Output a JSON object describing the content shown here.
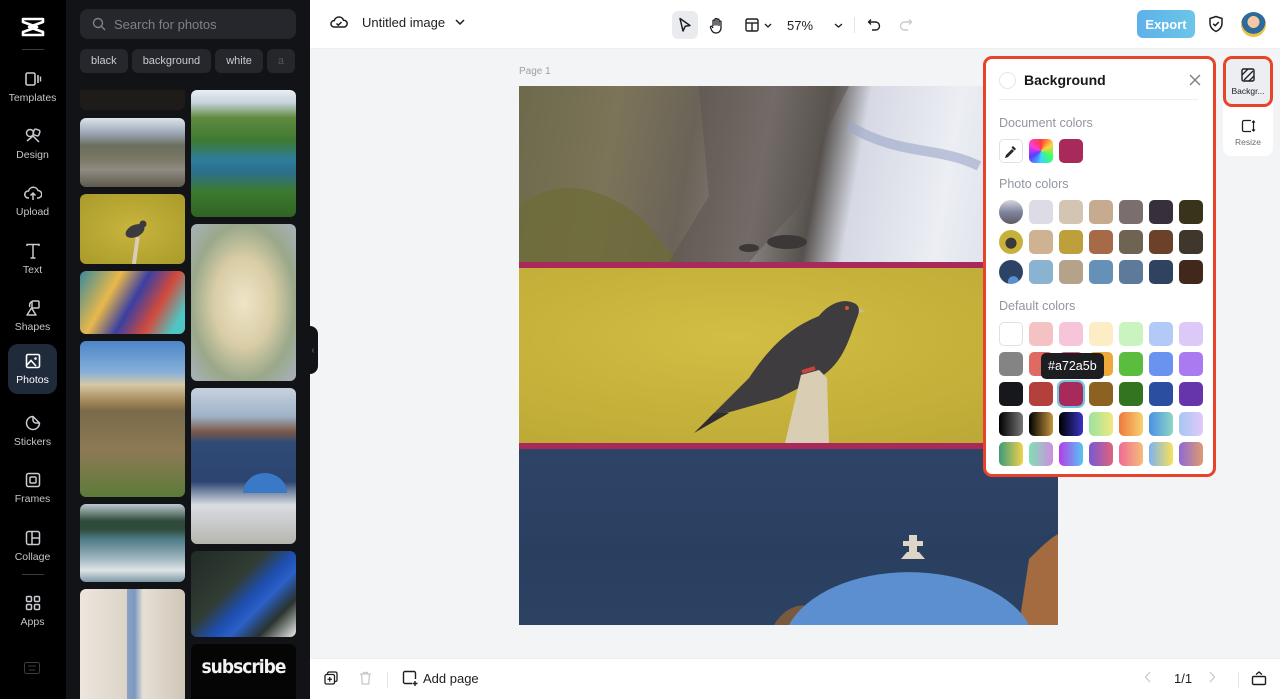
{
  "rail": {
    "items": [
      {
        "id": "templates",
        "label": "Templates",
        "icon": "templates-icon"
      },
      {
        "id": "design",
        "label": "Design",
        "icon": "design-icon"
      },
      {
        "id": "upload",
        "label": "Upload",
        "icon": "upload-icon"
      },
      {
        "id": "text",
        "label": "Text",
        "icon": "text-icon"
      },
      {
        "id": "shapes",
        "label": "Shapes",
        "icon": "shapes-icon"
      },
      {
        "id": "photos",
        "label": "Photos",
        "icon": "photos-icon",
        "active": true
      },
      {
        "id": "stickers",
        "label": "Stickers",
        "icon": "stickers-icon"
      },
      {
        "id": "frames",
        "label": "Frames",
        "icon": "frames-icon"
      },
      {
        "id": "collage",
        "label": "Collage",
        "icon": "collage-icon"
      },
      {
        "id": "apps",
        "label": "Apps",
        "icon": "apps-icon"
      }
    ]
  },
  "photos_panel": {
    "search_placeholder": "Search for photos",
    "chips": [
      "black",
      "background",
      "white",
      "a"
    ],
    "thumbnails": [
      {
        "name": "dark-texture",
        "col": 0
      },
      {
        "name": "mountain-lake",
        "col": 0
      },
      {
        "name": "pigeon-yellow",
        "col": 0
      },
      {
        "name": "abstract-swirl",
        "col": 0
      },
      {
        "name": "ponte-vecchio",
        "col": 0
      },
      {
        "name": "lake-reflection",
        "col": 0
      },
      {
        "name": "closet-shelves",
        "col": 0
      },
      {
        "name": "river-valley",
        "col": 1
      },
      {
        "name": "chicken-lemon-tray",
        "col": 1
      },
      {
        "name": "santorini-dome",
        "col": 1
      },
      {
        "name": "loan-keyboard",
        "col": 1
      },
      {
        "name": "subscribe-sign",
        "col": 1
      }
    ],
    "subscribe_text": "subscribe"
  },
  "topbar": {
    "doc_title": "Untitled image",
    "zoom": "57%",
    "export_label": "Export"
  },
  "canvas": {
    "page_label": "Page 1",
    "background_color": "#a72a5b"
  },
  "bottombar": {
    "add_page_label": "Add page",
    "page_indicator": "1/1"
  },
  "background_panel": {
    "title": "Background",
    "document_colors_label": "Document colors",
    "document_colors": [
      "#a72a5b"
    ],
    "photo_colors_label": "Photo colors",
    "photo_colors": [
      [
        "#dcdbe6",
        "#d3c5b1",
        "#c6ab90",
        "#7a6e6e",
        "#37303c",
        "#3a331c"
      ],
      [
        "#cfb291",
        "#bda03c",
        "#a76a48",
        "#6f6351",
        "#6c4129",
        "#3f362c"
      ],
      [
        "#8ab3d2",
        "#b5a28b",
        "#6591b9",
        "#5d7a9b",
        "#2f4260",
        "#42281c"
      ]
    ],
    "default_colors_label": "Default colors",
    "default_colors": [
      [
        "#ffffff",
        "#f4c2c2",
        "#f6c5da",
        "#fcedc6",
        "#c9f4bf",
        "#b3c9f8",
        "#dcc9f8"
      ],
      [
        "#848484",
        "#de6a63",
        "#e05a8a",
        "#eda93c",
        "#5abd3e",
        "#6a93f0",
        "#a97af0"
      ],
      [
        "#17181c",
        "#b3403a",
        "#a72a5b",
        "#8b6220",
        "#33741f",
        "#2b4ea1",
        "#6735ab"
      ]
    ],
    "default_gradients": [
      [
        "linear-gradient(90deg,#000,#777)",
        "linear-gradient(90deg,#000,#c49540)",
        "linear-gradient(90deg,#000,#3a34c2)",
        "linear-gradient(90deg,#9ae3a0,#f1e87f)",
        "linear-gradient(90deg,#ee7a3c,#f6d270)",
        "linear-gradient(90deg,#4a91e8,#8fd6c4)",
        "linear-gradient(90deg,#a7c6f6,#e0c9f8)"
      ],
      [
        "linear-gradient(90deg,#3d9a7a,#f3d24a)",
        "linear-gradient(90deg,#7fe0b4,#d18de0)",
        "linear-gradient(90deg,#b43ee8,#55c5f2)",
        "linear-gradient(90deg,#7957d6,#e0637b)",
        "linear-gradient(90deg,#ee6c97,#f6bd78)",
        "linear-gradient(90deg,#7fb2f0,#f6e25a)",
        "linear-gradient(90deg,#8d6ad6,#e09a6e)"
      ]
    ],
    "hover_tooltip": "#a72a5b"
  },
  "side_tools": {
    "background_label": "Backgr...",
    "resize_label": "Resize"
  }
}
